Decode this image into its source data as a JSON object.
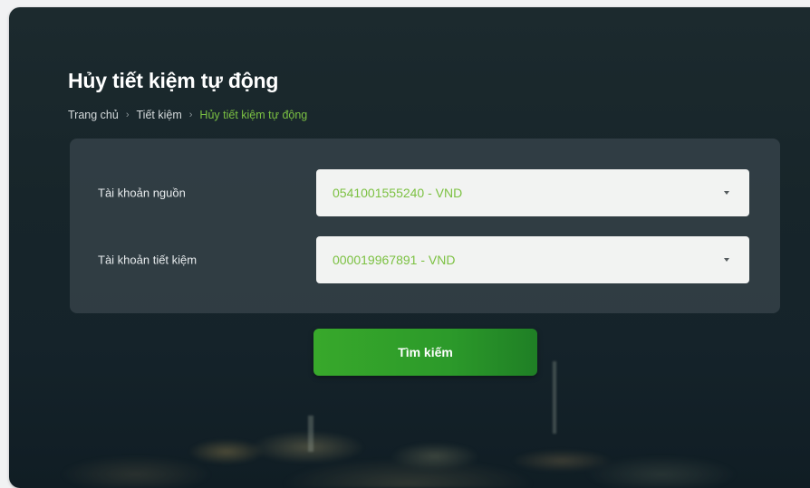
{
  "page": {
    "title": "Hủy tiết kiệm tự động"
  },
  "breadcrumb": {
    "items": [
      "Trang chủ",
      "Tiết kiệm",
      "Hủy tiết kiệm tự động"
    ],
    "separator": "›"
  },
  "form": {
    "source_account": {
      "label": "Tài khoản nguồn",
      "value": "0541001555240 - VND"
    },
    "savings_account": {
      "label": "Tài khoản tiết kiệm",
      "value": "000019967891 - VND"
    }
  },
  "actions": {
    "search_label": "Tìm kiếm"
  },
  "colors": {
    "accent": "#7bc143",
    "button": "#2c9a2a",
    "background": "#17252a"
  },
  "icons": {
    "dropdown": "caret-down-icon"
  }
}
